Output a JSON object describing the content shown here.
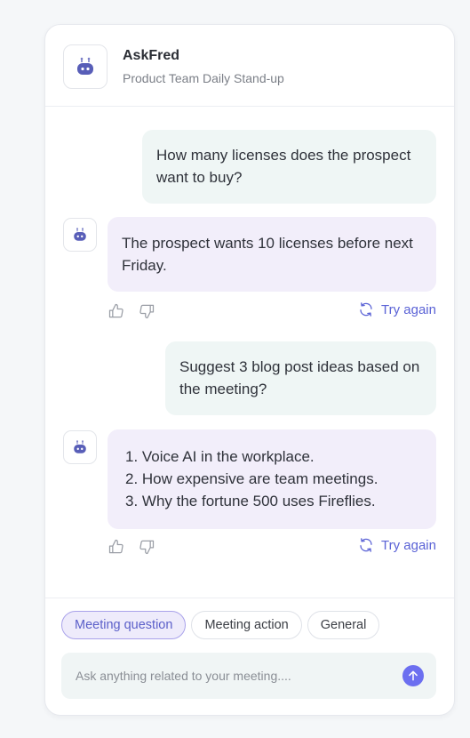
{
  "header": {
    "title": "AskFred",
    "subtitle": "Product Team Daily Stand-up"
  },
  "messages": [
    {
      "role": "user",
      "text": "How many licenses does the prospect want to buy?"
    },
    {
      "role": "bot",
      "text": "The prospect wants 10 licenses before next Friday.",
      "try_again": "Try again"
    },
    {
      "role": "user",
      "text": "Suggest 3 blog post ideas based on the meeting?"
    },
    {
      "role": "bot",
      "lines": [
        "1. Voice AI in the workplace.",
        "2. How expensive are team meetings.",
        "3. Why the fortune 500 uses Fireflies."
      ],
      "try_again": "Try again"
    }
  ],
  "chips": [
    {
      "label": "Meeting question",
      "active": true
    },
    {
      "label": "Meeting action",
      "active": false
    },
    {
      "label": "General",
      "active": false
    }
  ],
  "input": {
    "placeholder": "Ask anything related to your meeting....",
    "value": ""
  },
  "icons": {
    "bot": "robot-icon",
    "like": "thumbs-up-icon",
    "dislike": "thumbs-down-icon",
    "retry": "refresh-icon",
    "send": "arrow-up-icon"
  },
  "colors": {
    "accent": "#5b63d6",
    "send_button": "#6c6ff0",
    "user_bubble": "#eff6f5",
    "bot_bubble": "#f2eefa",
    "bot_icon": "#585eb8"
  }
}
